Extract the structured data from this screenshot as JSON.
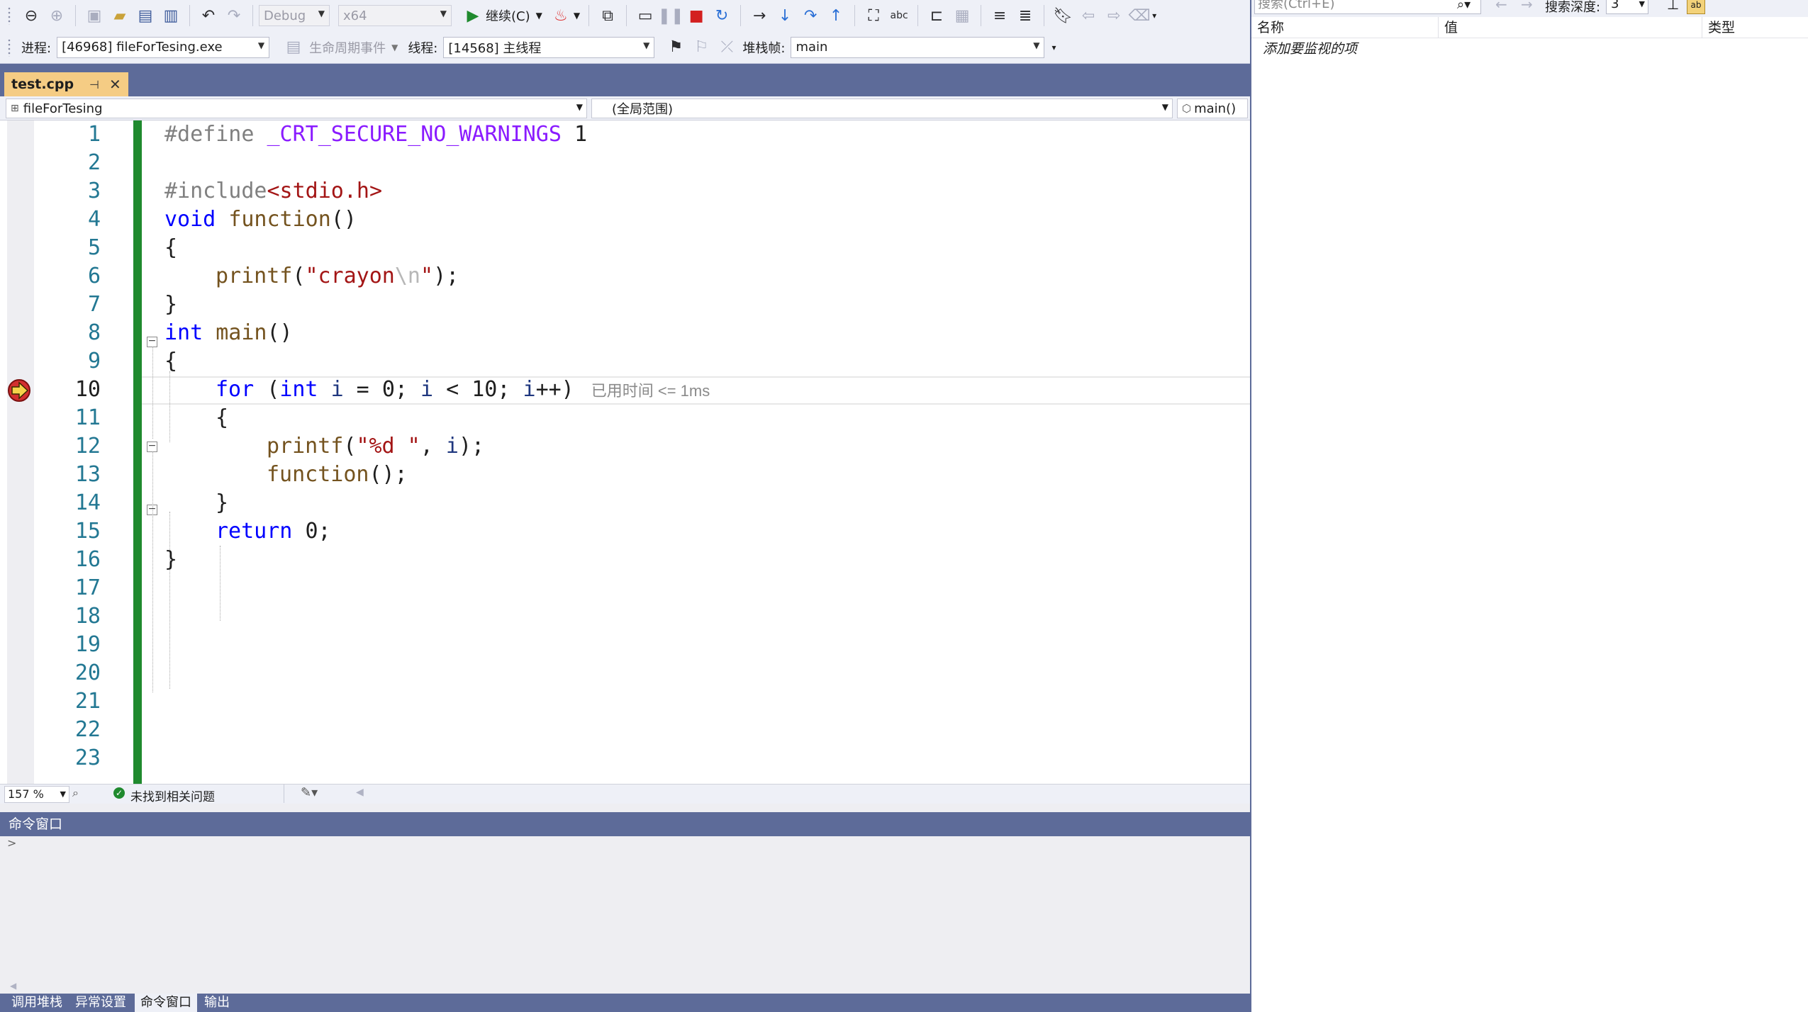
{
  "toolbar": {
    "config": "Debug",
    "platform": "x64",
    "continue_label": "继续(C)",
    "process_label": "进程:",
    "process_value": "[46968] fileForTesing.exe",
    "lifecycle_label": "生命周期事件",
    "thread_label": "线程:",
    "thread_value": "[14568] 主线程",
    "stackframe_label": "堆栈帧:",
    "stackframe_value": "main"
  },
  "tab": {
    "title": "test.cpp"
  },
  "navbar": {
    "project": "fileForTesing",
    "scope": "(全局范围)",
    "member": "main()"
  },
  "editor": {
    "current_line": 10,
    "line_numbers": [
      "1",
      "2",
      "3",
      "4",
      "5",
      "6",
      "7",
      "8",
      "9",
      "10",
      "11",
      "12",
      "13",
      "14",
      "15",
      "16",
      "17",
      "18",
      "19",
      "20",
      "21",
      "22",
      "23"
    ],
    "code": {
      "l1_define": "#define",
      "l1_macro": "_CRT_SECURE_NO_WARNINGS",
      "l1_value": "1",
      "l3_include": "#include",
      "l3_header": "<stdio.h>",
      "l4_kw": "void",
      "l4_fn": "function",
      "l4_rest": "()",
      "l5": "{",
      "l6_fn": "printf",
      "l6_open": "(",
      "l6_str1": "\"crayon",
      "l6_esc": "\\n",
      "l6_str2": "\"",
      "l6_close": ");",
      "l7": "}",
      "l8_kw": "int",
      "l8_fn": "main",
      "l8_rest": "()",
      "l9": "{",
      "l10_for": "for",
      "l10_p1": " (",
      "l10_int": "int",
      "l10_i1": "i",
      "l10_p2": " = ",
      "l10_zero": "0",
      "l10_p3": "; ",
      "l10_i2": "i",
      "l10_p4": " < ",
      "l10_ten": "10",
      "l10_p5": "; ",
      "l10_i3": "i",
      "l10_p6": "++)",
      "l10_hint": "已用时间 <= 1ms",
      "l11": "{",
      "l12_fn": "printf",
      "l12_open": "(",
      "l12_str": "\"%d \"",
      "l12_comma": ", ",
      "l12_i": "i",
      "l12_close": ");",
      "l13_fn": "function",
      "l13_rest": "();",
      "l14": "}",
      "l15_kw": "return",
      "l15_sp": " ",
      "l15_zero": "0",
      "l15_semi": ";",
      "l16": "}"
    }
  },
  "status": {
    "zoom": "157 %",
    "issues": "未找到相关问题"
  },
  "command_window": {
    "title": "命令窗口",
    "prompt": ">"
  },
  "bottom_tabs": [
    "调用堆栈",
    "异常设置",
    "命令窗口",
    "输出"
  ],
  "watch": {
    "search_placeholder": "搜索(Ctrl+E)",
    "search_depth_label": "搜索深度:",
    "search_depth_value": "3",
    "col_name": "名称",
    "col_value": "值",
    "col_type": "类型",
    "add_item": "添加要监视的项"
  }
}
